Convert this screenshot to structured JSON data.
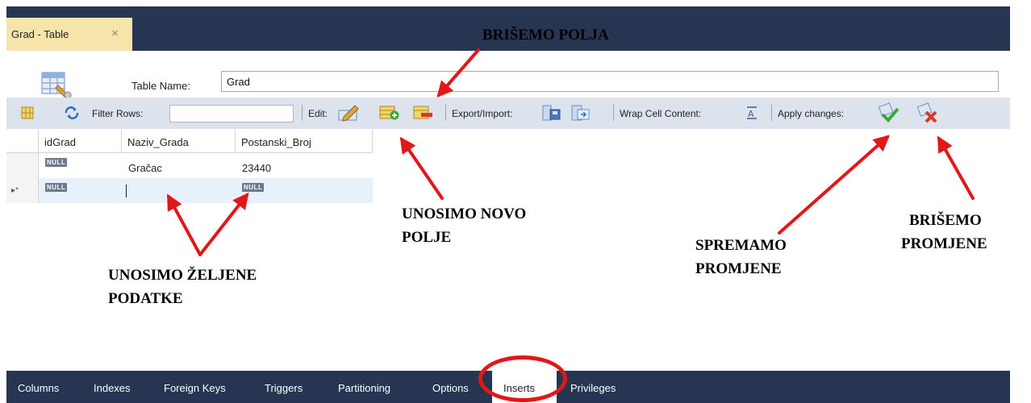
{
  "window": {
    "tab_title": "Grad - Table",
    "tab_close": "×"
  },
  "name_bar": {
    "label": "Table Name:",
    "value": "Grad"
  },
  "toolbar": {
    "filter_label": "Filter Rows:",
    "edit_label": "Edit:",
    "export_label": "Export/Import:",
    "wrap_label": "Wrap Cell Content:",
    "apply_label": "Apply changes:"
  },
  "grid": {
    "columns": [
      "idGrad",
      "Naziv_Grada",
      "Postanski_Broj"
    ],
    "rows": [
      {
        "row_marker": "",
        "idGrad": "NULL",
        "Naziv_Grada": "Gračac",
        "Postanski_Broj": "23440"
      },
      {
        "row_marker": "▸*",
        "idGrad": "NULL",
        "Naziv_Grada": "",
        "Postanski_Broj": "NULL"
      }
    ]
  },
  "bottom_tabs": [
    "Columns",
    "Indexes",
    "Foreign Keys",
    "Triggers",
    "Partitioning",
    "Options",
    "Inserts",
    "Privileges"
  ],
  "active_bottom_tab": "Inserts",
  "annotations": {
    "delete_fields": "BRIŠEMO POLJA",
    "new_field_1": "UNOSIMO NOVO",
    "new_field_2": "POLJE",
    "enter_data_1": "UNOSIMO ŽELJENE",
    "enter_data_2": "PODATKE",
    "save_1": "SPREMAMO",
    "save_2": "PROMJENE",
    "discard_1": "BRIŠEMO",
    "discard_2": "PROMJENE"
  },
  "colors": {
    "chrome_dark": "#253552",
    "tab_active": "#f6e4a8",
    "toolbar": "#dde3ec",
    "annotation_red": "#e21818"
  }
}
